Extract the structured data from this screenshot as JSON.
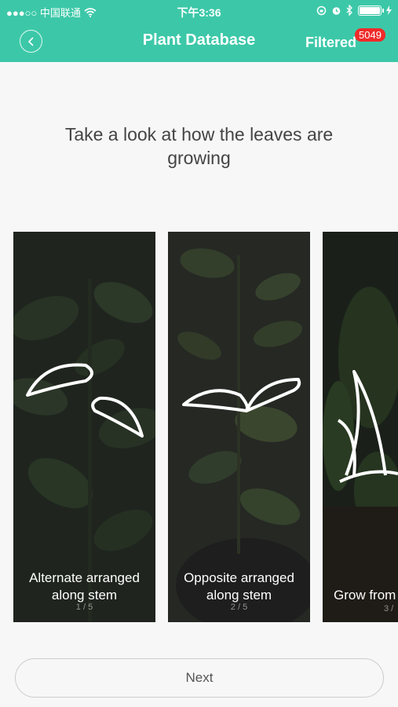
{
  "status_bar": {
    "carrier": "●●●○○ 中国联通",
    "time": "下午3:36"
  },
  "nav": {
    "title": "Plant Database",
    "filtered_label": "Filtered",
    "filtered_count": "5049"
  },
  "question": "Take a look at how the leaves are growing",
  "cards": [
    {
      "label_line1": "Alternate arranged",
      "label_line2": "along stem",
      "pager": "1 / 5"
    },
    {
      "label_line1": "Opposite arranged",
      "label_line2": "along stem",
      "pager": "2 / 5"
    },
    {
      "label_line1": "Grow from",
      "label_line2": "",
      "pager": "3 /"
    }
  ],
  "next_button": "Next",
  "colors": {
    "accent": "#3cc8a8",
    "badge": "#f02a2a"
  }
}
